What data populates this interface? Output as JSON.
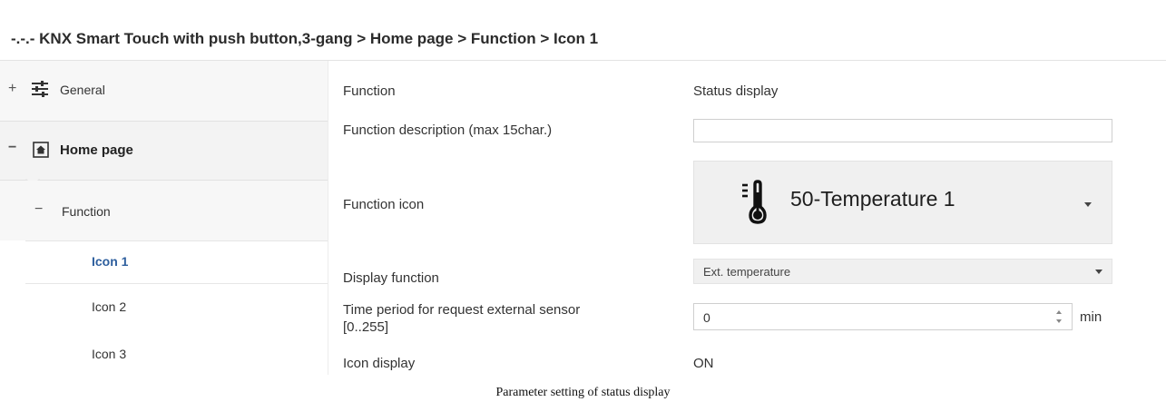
{
  "header": {
    "breadcrumb": "-.-.- KNX Smart Touch with push button,3-gang > Home page > Function > Icon 1"
  },
  "sidebar": {
    "general": {
      "sign": "+",
      "label": "General"
    },
    "home": {
      "sign": "−",
      "label": "Home page"
    },
    "function": {
      "sign": "−",
      "label": "Function"
    },
    "icons": [
      "Icon 1",
      "Icon 2",
      "Icon 3"
    ],
    "active_color": "#2e5f9e"
  },
  "params": {
    "function": {
      "label": "Function",
      "value": "Status display"
    },
    "description": {
      "label": "Function description (max 15char.)",
      "value": ""
    },
    "icon": {
      "label": "Function icon",
      "value": "50-Temperature 1",
      "icon_name": "thermometer-icon"
    },
    "display_function": {
      "label": "Display function",
      "value": "Ext. temperature"
    },
    "time_period": {
      "label_line1": "Time period for request external sensor",
      "label_line2": "[0..255]",
      "value": "0",
      "unit": "min"
    },
    "icon_display": {
      "label": "Icon display",
      "value": "ON"
    }
  },
  "caption": "Parameter setting of status display"
}
